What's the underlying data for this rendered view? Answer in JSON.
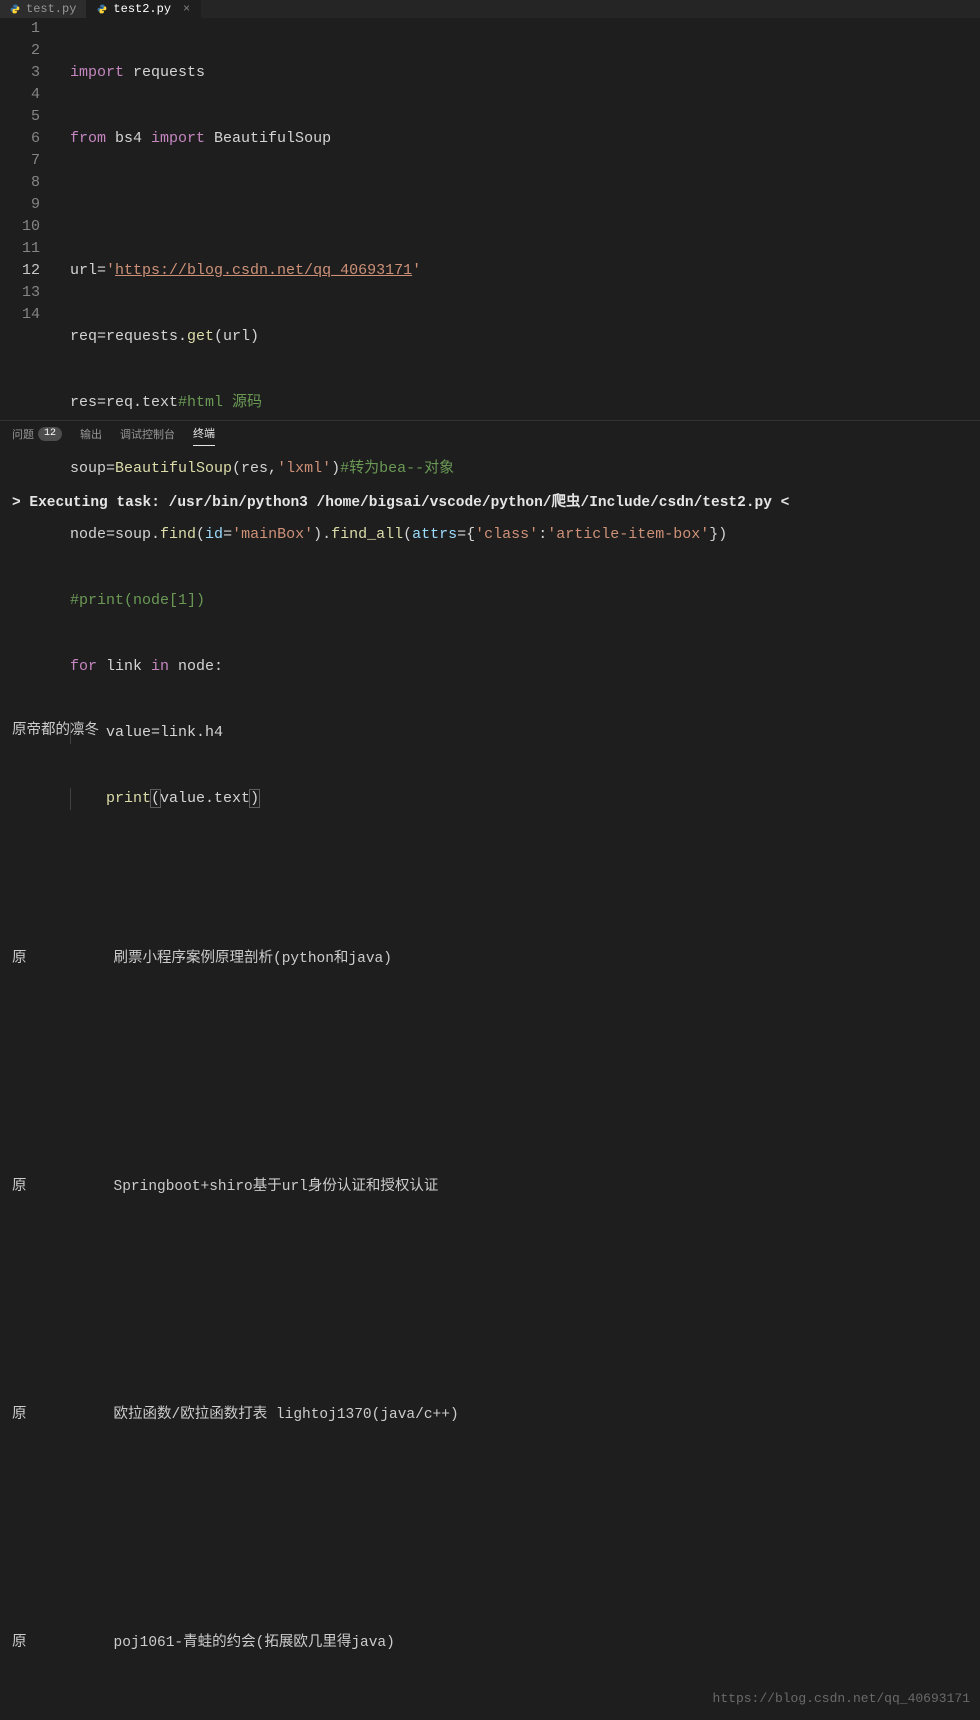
{
  "tabs": [
    {
      "label": "test.py",
      "active": false
    },
    {
      "label": "test2.py",
      "active": true
    }
  ],
  "close_glyph": "×",
  "gutter": {
    "lines": [
      "1",
      "2",
      "3",
      "4",
      "5",
      "6",
      "7",
      "8",
      "9",
      "10",
      "11",
      "12",
      "13",
      "14"
    ],
    "current": 12
  },
  "code": {
    "l1": {
      "kw": "import",
      "rest": " requests"
    },
    "l2": {
      "kw1": "from",
      "mid": " bs4 ",
      "kw2": "import",
      "rest": " BeautifulSoup"
    },
    "l4": {
      "pre": "url=",
      "q1": "'",
      "url": "https://blog.csdn.net/qq_40693171",
      "q2": "'"
    },
    "l5": {
      "a": "req=requests.",
      "fn": "get",
      "b": "(url)"
    },
    "l6": {
      "a": "res=req.text",
      "cmt": "#html 源码"
    },
    "l7": {
      "a": "soup=",
      "fn": "BeautifulSoup",
      "b": "(res,",
      "str": "'lxml'",
      "c": ")",
      "cmt": "#转为bea--对象"
    },
    "l8": {
      "a": "node=soup.",
      "fn1": "find",
      "b": "(",
      "kw1": "id",
      "c": "=",
      "str1": "'mainBox'",
      "d": ").",
      "fn2": "find_all",
      "e": "(",
      "kw2": "attrs",
      "f": "={",
      "str2": "'class'",
      "g": ":",
      "str3": "'article-item-box'",
      "h": "})"
    },
    "l9": {
      "cmt": "#print(node[1])"
    },
    "l10": {
      "kw1": "for",
      "a": " link ",
      "kw2": "in",
      "b": " node:"
    },
    "l11": {
      "a": "    value=link.h4"
    },
    "l12": {
      "pad": "    ",
      "fn": "print",
      "lp": "(",
      "arg": "value.text",
      "rp": ")"
    }
  },
  "panel_tabs": {
    "problems": "问题",
    "problems_count": "12",
    "output": "输出",
    "debug": "调试控制台",
    "terminal": "终端"
  },
  "terminal": {
    "exec": "> Executing task: /usr/bin/python3 /home/bigsai/vscode/python/爬虫/Include/csdn/test2.py <",
    "lines": [
      "",
      "",
      "",
      "原帝都的凛冬",
      "",
      "",
      "",
      "原          刷票小程序案例原理剖析(python和java)",
      "",
      "",
      "",
      "原          Springboot+shiro基于url身份认证和授权认证",
      "",
      "",
      "",
      "原          欧拉函数/欧拉函数打表 lightoj1370(java/c++)",
      "",
      "",
      "",
      "原          poj1061-青蛙的约会(拓展欧几里得java)"
    ]
  },
  "watermark": "https://blog.csdn.net/qq_40693171"
}
